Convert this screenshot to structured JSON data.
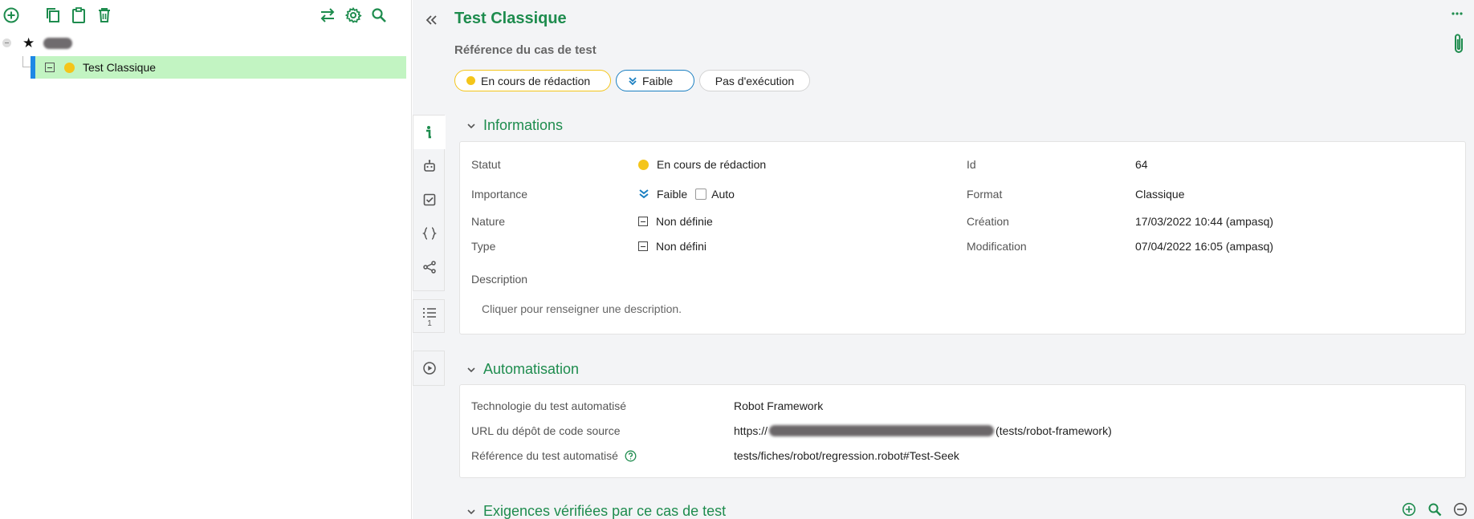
{
  "tree": {
    "selected_item_label": "Test Classique"
  },
  "header": {
    "title": "Test Classique",
    "reference_label": "Référence du cas de test"
  },
  "pills": {
    "status": "En cours de rédaction",
    "importance": "Faible",
    "execution": "Pas d'exécution"
  },
  "info": {
    "heading": "Informations",
    "statut_label": "Statut",
    "statut_value": "En cours de rédaction",
    "importance_label": "Importance",
    "importance_value": "Faible",
    "auto_label": "Auto",
    "nature_label": "Nature",
    "nature_value": "Non définie",
    "type_label": "Type",
    "type_value": "Non défini",
    "id_label": "Id",
    "id_value": "64",
    "format_label": "Format",
    "format_value": "Classique",
    "creation_label": "Création",
    "creation_value": "17/03/2022 10:44 (ampasq)",
    "modification_label": "Modification",
    "modification_value": "07/04/2022 16:05 (ampasq)",
    "description_label": "Description",
    "description_placeholder": "Cliquer pour renseigner une description."
  },
  "automation": {
    "heading": "Automatisation",
    "tech_label": "Technologie du test automatisé",
    "tech_value": "Robot Framework",
    "url_label": "URL du dépôt de code source",
    "url_prefix": "https://",
    "url_suffix": "(tests/robot-framework)",
    "ref_label": "Référence du test automatisé",
    "ref_value": "tests/fiches/robot/regression.robot#Test-Seek"
  },
  "requirements": {
    "heading": "Exigences vérifiées par ce cas de test"
  },
  "side_tab_badge": "1",
  "colors": {
    "brand_green": "#1e8c4e",
    "status_yellow": "#f4c51a",
    "importance_blue": "#1a7fc1",
    "selection_bg": "#c2f4c2",
    "selection_bar": "#1e88e5"
  }
}
